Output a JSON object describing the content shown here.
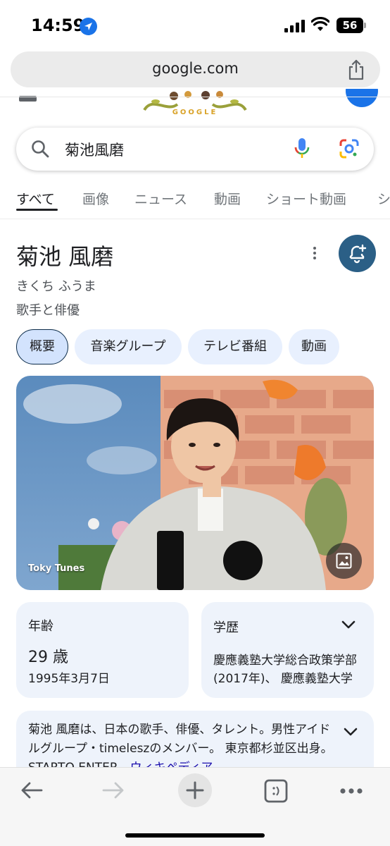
{
  "status_bar": {
    "time": "14:59",
    "battery": "56"
  },
  "browser": {
    "url": "google.com"
  },
  "search": {
    "query": "菊池風磨"
  },
  "tabs": [
    {
      "label": "すべて",
      "active": true
    },
    {
      "label": "画像"
    },
    {
      "label": "ニュース"
    },
    {
      "label": "動画"
    },
    {
      "label": "ショート動画"
    },
    {
      "label": "シ"
    }
  ],
  "knowledge_panel": {
    "title": "菊池 風磨",
    "reading": "きくち ふうま",
    "description": "歌手と俳優",
    "chips": [
      "概要",
      "音楽グループ",
      "テレビ番組",
      "動画"
    ],
    "image_credit": "Toky Tunes",
    "facts": {
      "age": {
        "label": "年齢",
        "value": "29 歳",
        "sub": "1995年3月7日"
      },
      "education": {
        "label": "学歴",
        "value": "慶應義塾大学総合政策学部 (2017年)、 慶應義塾大学"
      }
    },
    "bio": {
      "text": "菊池 風磨は、日本の歌手、俳優、タレント。男性アイドルグループ・timeleszのメンバー。 東京都杉並区出身。STARTO ENTER…",
      "source": "ウィキペディア"
    }
  },
  "colors": {
    "accent": "#1a73e8",
    "follow_button": "#2b5f86",
    "chip_bg": "#e8f0fe",
    "card_bg": "#eef3fb"
  }
}
